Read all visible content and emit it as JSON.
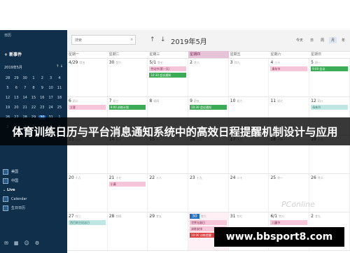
{
  "sidebar": {
    "app_label": "日历",
    "new_event": "+  新事件",
    "month_label": "2019年5月",
    "arrows": "↑  ↓",
    "minical_rows": [
      [
        "28",
        "29",
        "30",
        "1",
        "2",
        "3",
        "4"
      ],
      [
        "5",
        "6",
        "7",
        "8",
        "9",
        "10",
        "11"
      ],
      [
        "12",
        "13",
        "14",
        "15",
        "16",
        "17",
        "18"
      ],
      [
        "19",
        "20",
        "21",
        "22",
        "23",
        "24",
        "25"
      ],
      [
        "26",
        "27",
        "28",
        "29",
        "30",
        "31",
        "1"
      ],
      [
        "2",
        "3",
        "4",
        "5",
        "6",
        "7",
        "8"
      ]
    ],
    "calendars": [
      {
        "label": "美国"
      },
      {
        "label": "中国"
      }
    ],
    "live_header": "Live",
    "live_items": [
      {
        "label": "Calendar"
      },
      {
        "label": "生日日历"
      }
    ],
    "footer_icons": [
      "mail-icon",
      "calendar-icon",
      "people-icon",
      "gear-icon"
    ]
  },
  "toolbar": {
    "search_placeholder": "搜索",
    "month": "2019年5月",
    "buttons": [
      "今天",
      "日",
      "周",
      "月",
      "年"
    ]
  },
  "calendar": {
    "weekdays": [
      "星期一",
      "星期二",
      "星期三",
      "星期四",
      "星期五",
      "星期六",
      "星期日"
    ],
    "weeks": [
      [
        {
          "num": "4/29",
          "sub": "廿五",
          "events": []
        },
        {
          "num": "30",
          "sub": "廿六",
          "events": []
        },
        {
          "num": "5/1",
          "sub": "廿七",
          "events": [
            {
              "t": "劳动节(第一天)",
              "c": "pink"
            },
            {
              "t": "10:30 会议通知",
              "c": "green"
            }
          ]
        },
        {
          "num": "2",
          "sub": "廿八",
          "events": []
        },
        {
          "num": "3",
          "sub": "廿九",
          "events": []
        },
        {
          "num": "4",
          "sub": "三十",
          "events": [
            {
              "t": "青年节",
              "c": "pink"
            }
          ]
        },
        {
          "num": "5",
          "sub": "初一",
          "events": [
            {
              "t": "9:00 会议",
              "c": "green"
            }
          ]
        }
      ],
      [
        {
          "num": "6",
          "sub": "初二",
          "events": [
            {
              "t": "立夏",
              "c": "pink"
            }
          ]
        },
        {
          "num": "7",
          "sub": "初三",
          "events": [
            {
              "t": "9:00 训练计划",
              "c": "green"
            }
          ]
        },
        {
          "num": "8",
          "sub": "初四",
          "events": []
        },
        {
          "num": "9",
          "sub": "初五",
          "events": [
            {
              "t": "10:30 会议通知",
              "c": "green"
            }
          ]
        },
        {
          "num": "10",
          "sub": "初六",
          "events": []
        },
        {
          "num": "11",
          "sub": "初七",
          "events": []
        },
        {
          "num": "12",
          "sub": "初八",
          "events": [
            {
              "t": "母亲节",
              "c": "teal"
            }
          ]
        }
      ],
      [
        {
          "num": "13",
          "sub": "初九",
          "events": []
        },
        {
          "num": "14",
          "sub": "初十",
          "events": []
        },
        {
          "num": "15",
          "sub": "十一",
          "events": []
        },
        {
          "num": "16",
          "sub": "十二",
          "events": []
        },
        {
          "num": "17",
          "sub": "十三",
          "events": []
        },
        {
          "num": "18",
          "sub": "十四",
          "events": []
        },
        {
          "num": "19",
          "sub": "十五",
          "events": []
        }
      ],
      [
        {
          "num": "20",
          "sub": "十六",
          "events": []
        },
        {
          "num": "21",
          "sub": "十七",
          "events": [
            {
              "t": "小满",
              "c": "pink"
            }
          ]
        },
        {
          "num": "22",
          "sub": "十八",
          "events": []
        },
        {
          "num": "23",
          "sub": "十九",
          "events": []
        },
        {
          "num": "24",
          "sub": "二十",
          "events": []
        },
        {
          "num": "25",
          "sub": "廿一",
          "events": []
        },
        {
          "num": "26",
          "sub": "廿二",
          "events": []
        }
      ],
      [
        {
          "num": "27",
          "sub": "廿三",
          "events": [
            {
              "t": "西巴耐主纪念日",
              "c": "teal"
            }
          ]
        },
        {
          "num": "28",
          "sub": "廿四",
          "events": []
        },
        {
          "num": "29",
          "sub": "廿五",
          "events": []
        },
        {
          "num": "30",
          "sub": "廿六",
          "today": true,
          "events": [
            {
              "t": "世界无烟日",
              "c": "pink"
            },
            {
              "t": "训练安排",
              "c": "pink"
            },
            {
              "t": "10:00 训练提醒",
              "c": "red"
            }
          ]
        },
        {
          "num": "31",
          "sub": "廿七",
          "events": []
        },
        {
          "num": "6/1",
          "sub": "廿八",
          "events": [
            {
              "t": "儿童节",
              "c": "pink"
            }
          ]
        },
        {
          "num": "2",
          "sub": "廿九",
          "events": []
        }
      ]
    ]
  },
  "overlay": {
    "banner_text": "体育训练日历与平台消息通知系统中的高效日程提醒机制设计与应用",
    "watermark": "PConline",
    "url": "www.bbsport8.com"
  }
}
